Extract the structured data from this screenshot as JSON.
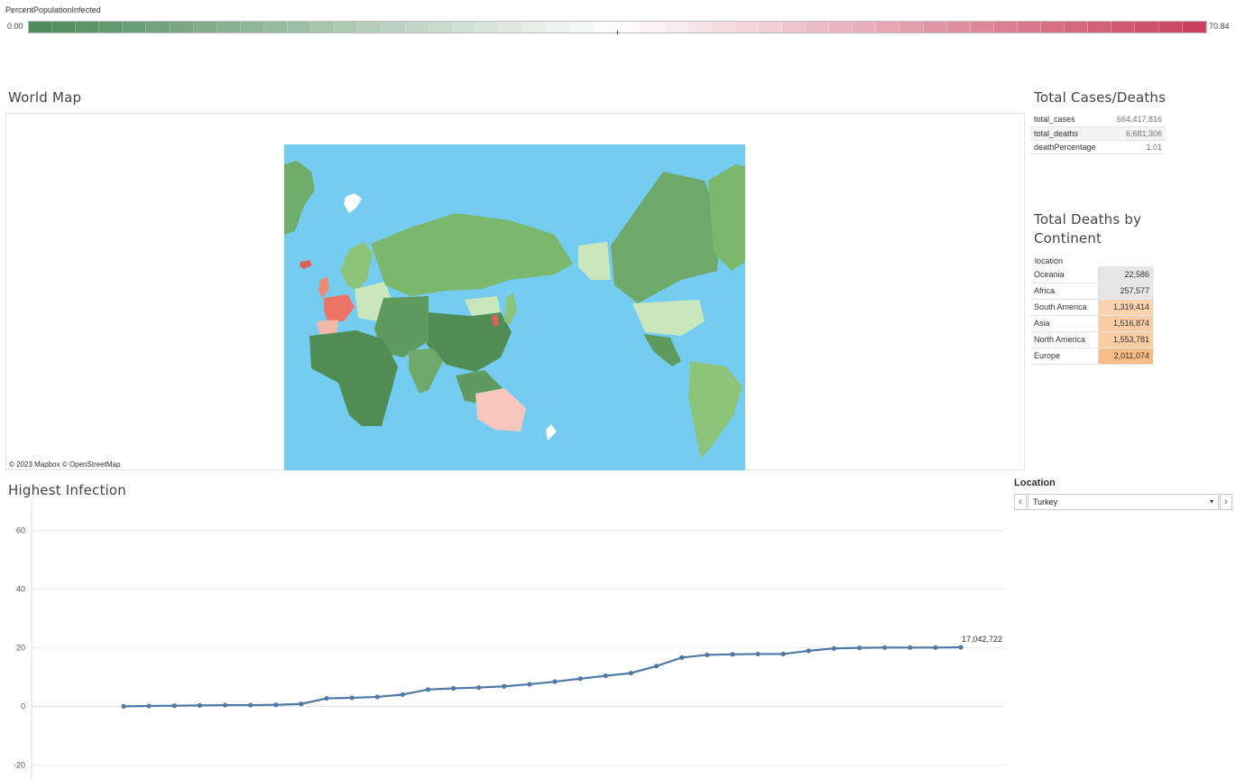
{
  "legend": {
    "title": "PercentPopulationInfected",
    "min_label": "0.00",
    "max_label": "70.84",
    "low_color": "#4e8b5b",
    "mid_color": "#ffffff",
    "high_color": "#c9415d"
  },
  "map": {
    "title": "World Map",
    "attribution": "© 2023 Mapbox  © OpenStreetMap",
    "ocean_color": "#74cdf0"
  },
  "totals": {
    "title": "Total Cases/Deaths",
    "rows": [
      {
        "label": "total_cases",
        "value": "664,417,816"
      },
      {
        "label": "total_deaths",
        "value": "6,681,306"
      },
      {
        "label": "deathPercentage",
        "value": "1.01"
      }
    ]
  },
  "continents": {
    "title_line1": "Total Deaths by",
    "title_line2": "Continent",
    "column_header": "location",
    "rows": [
      {
        "name": "Oceania",
        "value": "22,586",
        "color": "#e6e6e6"
      },
      {
        "name": "Africa",
        "value": "257,577",
        "color": "#e6e6e6"
      },
      {
        "name": "South America",
        "value": "1,319,414",
        "color": "#fcd3b0"
      },
      {
        "name": "Asia",
        "value": "1,516,874",
        "color": "#fccda5"
      },
      {
        "name": "North America",
        "value": "1,553,781",
        "color": "#fccca3"
      },
      {
        "name": "Europe",
        "value": "2,011,074",
        "color": "#fbbd85"
      }
    ]
  },
  "location_filter": {
    "label": "Location",
    "selected": "Turkey",
    "prev_icon": "‹",
    "next_icon": "›",
    "caret_icon": "▾"
  },
  "chart": {
    "title": "Highest Infection",
    "line_color": "#4e79a7",
    "end_label": "17,042,722"
  },
  "chart_data": {
    "type": "line",
    "title": "Highest Infection",
    "xlabel": "",
    "ylabel": "",
    "ylim": [
      -25,
      70
    ],
    "yticks": [
      60,
      40,
      20,
      0,
      -20
    ],
    "grid": true,
    "series": [
      {
        "values": [
          0.1,
          0.2,
          0.3,
          0.4,
          0.5,
          0.5,
          0.6,
          0.9,
          2.8,
          3.0,
          3.3,
          4.1,
          5.8,
          6.2,
          6.5,
          6.9,
          7.6,
          8.5,
          9.5,
          10.5,
          11.4,
          13.8,
          16.7,
          17.6,
          17.8,
          17.9,
          17.9,
          19.0,
          19.8,
          20.0,
          20.1,
          20.1,
          20.1,
          20.2
        ]
      }
    ]
  }
}
